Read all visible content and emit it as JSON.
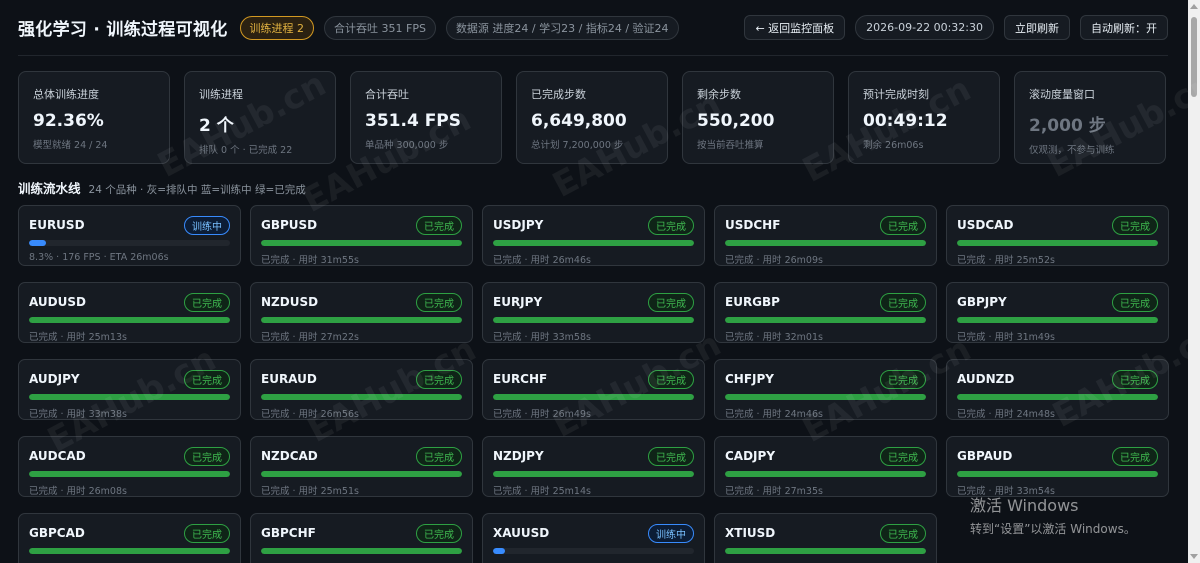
{
  "header": {
    "title": "强化学习 · 训练过程可视化",
    "progress_pill": "训练进程 2",
    "fps_pill": "合计吞吐 351 FPS",
    "source_pill": "数据源 进度24 / 学习23 / 指标24 / 验证24",
    "back_button": "← 返回监控面板",
    "timestamp": "2026-09-22 00:32:30",
    "refresh_button": "立即刷新",
    "auto_refresh_button": "自动刷新：开"
  },
  "metrics": [
    {
      "label": "总体训练进度",
      "value": "92.36%",
      "sub": "模型就绪 24 / 24",
      "dim": false
    },
    {
      "label": "训练进程",
      "value": "2 个",
      "sub": "排队 0 个 · 已完成 22",
      "dim": false
    },
    {
      "label": "合计吞吐",
      "value": "351.4 FPS",
      "sub": "单品种 300,000 步",
      "dim": false
    },
    {
      "label": "已完成步数",
      "value": "6,649,800",
      "sub": "总计划 7,200,000 步",
      "dim": false
    },
    {
      "label": "剩余步数",
      "value": "550,200",
      "sub": "按当前吞吐推算",
      "dim": false
    },
    {
      "label": "预计完成时刻",
      "value": "00:49:12",
      "sub": "剩余 26m06s",
      "dim": false
    },
    {
      "label": "滚动度量窗口",
      "value": "2,000 步",
      "sub": "仅观测，不参与训练",
      "dim": true
    }
  ],
  "pipeline": {
    "title": "训练流水线",
    "note": "24 个品种 · 灰=排队中 蓝=训练中 绿=已完成",
    "items": [
      {
        "symbol": "EURUSD",
        "status": "训练中",
        "state": "train",
        "progress": 0.083,
        "sub": "8.3% · 176 FPS · ETA 26m06s"
      },
      {
        "symbol": "GBPUSD",
        "status": "已完成",
        "state": "done",
        "progress": 1.0,
        "sub": "已完成 · 用时 31m55s"
      },
      {
        "symbol": "USDJPY",
        "status": "已完成",
        "state": "done",
        "progress": 1.0,
        "sub": "已完成 · 用时 26m46s"
      },
      {
        "symbol": "USDCHF",
        "status": "已完成",
        "state": "done",
        "progress": 1.0,
        "sub": "已完成 · 用时 26m09s"
      },
      {
        "symbol": "USDCAD",
        "status": "已完成",
        "state": "done",
        "progress": 1.0,
        "sub": "已完成 · 用时 25m52s"
      },
      {
        "symbol": "AUDUSD",
        "status": "已完成",
        "state": "done",
        "progress": 1.0,
        "sub": "已完成 · 用时 25m13s"
      },
      {
        "symbol": "NZDUSD",
        "status": "已完成",
        "state": "done",
        "progress": 1.0,
        "sub": "已完成 · 用时 27m22s"
      },
      {
        "symbol": "EURJPY",
        "status": "已完成",
        "state": "done",
        "progress": 1.0,
        "sub": "已完成 · 用时 33m58s"
      },
      {
        "symbol": "EURGBP",
        "status": "已完成",
        "state": "done",
        "progress": 1.0,
        "sub": "已完成 · 用时 32m01s"
      },
      {
        "symbol": "GBPJPY",
        "status": "已完成",
        "state": "done",
        "progress": 1.0,
        "sub": "已完成 · 用时 31m49s"
      },
      {
        "symbol": "AUDJPY",
        "status": "已完成",
        "state": "done",
        "progress": 1.0,
        "sub": "已完成 · 用时 33m38s"
      },
      {
        "symbol": "EURAUD",
        "status": "已完成",
        "state": "done",
        "progress": 1.0,
        "sub": "已完成 · 用时 26m56s"
      },
      {
        "symbol": "EURCHF",
        "status": "已完成",
        "state": "done",
        "progress": 1.0,
        "sub": "已完成 · 用时 26m49s"
      },
      {
        "symbol": "CHFJPY",
        "status": "已完成",
        "state": "done",
        "progress": 1.0,
        "sub": "已完成 · 用时 24m46s"
      },
      {
        "symbol": "AUDNZD",
        "status": "已完成",
        "state": "done",
        "progress": 1.0,
        "sub": "已完成 · 用时 24m48s"
      },
      {
        "symbol": "AUDCAD",
        "status": "已完成",
        "state": "done",
        "progress": 1.0,
        "sub": "已完成 · 用时 26m08s"
      },
      {
        "symbol": "NZDCAD",
        "status": "已完成",
        "state": "done",
        "progress": 1.0,
        "sub": "已完成 · 用时 25m51s"
      },
      {
        "symbol": "NZDJPY",
        "status": "已完成",
        "state": "done",
        "progress": 1.0,
        "sub": "已完成 · 用时 25m14s"
      },
      {
        "symbol": "CADJPY",
        "status": "已完成",
        "state": "done",
        "progress": 1.0,
        "sub": "已完成 · 用时 27m35s"
      },
      {
        "symbol": "GBPAUD",
        "status": "已完成",
        "state": "done",
        "progress": 1.0,
        "sub": "已完成 · 用时 33m54s"
      },
      {
        "symbol": "GBPCAD",
        "status": "已完成",
        "state": "done",
        "progress": 1.0,
        "sub": ""
      },
      {
        "symbol": "GBPCHF",
        "status": "已完成",
        "state": "done",
        "progress": 1.0,
        "sub": ""
      },
      {
        "symbol": "XAUUSD",
        "status": "训练中",
        "state": "train",
        "progress": 0.06,
        "sub": ""
      },
      {
        "symbol": "XTIUSD",
        "status": "已完成",
        "state": "done",
        "progress": 1.0,
        "sub": ""
      }
    ]
  },
  "watermark": "EAHub.cn",
  "activation": {
    "line1": "激活 Windows",
    "line2": "转到“设置”以激活 Windows。"
  }
}
